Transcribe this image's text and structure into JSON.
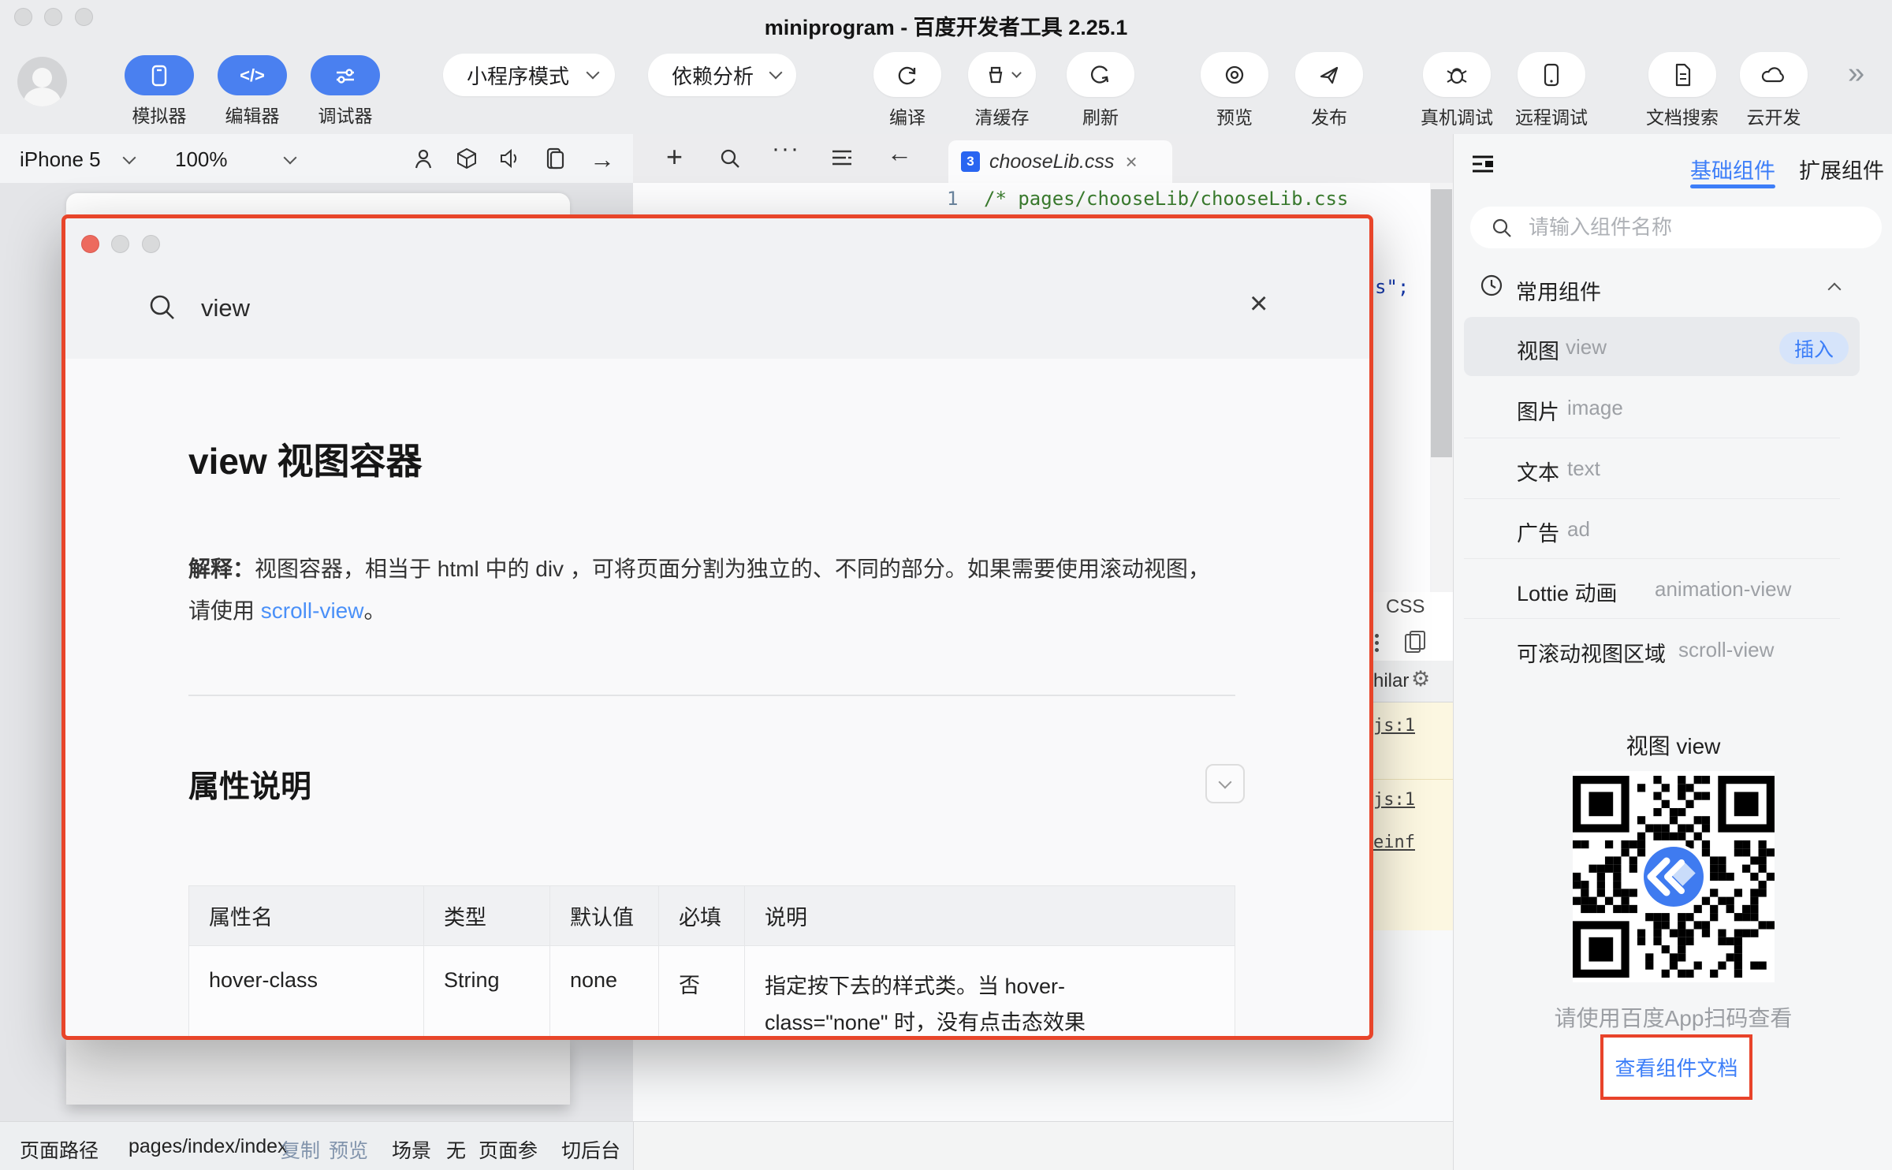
{
  "window": {
    "title": "miniprogram - 百度开发者工具 2.25.1"
  },
  "toolbar": {
    "toggles": [
      {
        "label": "模拟器"
      },
      {
        "label": "编辑器"
      },
      {
        "label": "调试器"
      }
    ],
    "mode_dropdown": "小程序模式",
    "analysis_dropdown": "依赖分析",
    "actions": [
      {
        "label": "编译"
      },
      {
        "label": "清缓存"
      },
      {
        "label": "刷新"
      },
      {
        "label": "预览"
      },
      {
        "label": "发布"
      },
      {
        "label": "真机调试"
      },
      {
        "label": "远程调试"
      },
      {
        "label": "文档搜索"
      },
      {
        "label": "云开发"
      }
    ],
    "more_glyph": "»"
  },
  "simbar": {
    "device": "iPhone 5",
    "zoom": "100%"
  },
  "editorbar": {
    "plus": "+",
    "ellipsis": "···",
    "back": "←",
    "forward": "→"
  },
  "editor": {
    "tab_name": "chooseLib.css",
    "tab_close": "×",
    "css_badge": "3",
    "line_number": "1",
    "line1": "/* pages/chooseLib/chooseLib.css",
    "line2_fragment": "s\";"
  },
  "devtools": {
    "css_tab": "CSS",
    "similar_fragment": "hilar",
    "gear_glyph": "⚙",
    "console_links": [
      "js:1",
      "js:1",
      "einf"
    ]
  },
  "components_panel": {
    "tabs": [
      "基础组件",
      "扩展组件"
    ],
    "search_placeholder": "请输入组件名称",
    "group_title": "常用组件",
    "items": [
      {
        "zh": "视图",
        "en": "view",
        "action": "插入"
      },
      {
        "zh": "图片",
        "en": "image"
      },
      {
        "zh": "文本",
        "en": "text"
      },
      {
        "zh": "广告",
        "en": "ad"
      },
      {
        "zh": "Lottie 动画",
        "en": "animation-view"
      },
      {
        "zh": "可滚动视图区域",
        "en": "scroll-view"
      }
    ],
    "preview_title": "视图 view",
    "qr_caption": "请使用百度App扫码查看",
    "doc_button": "查看组件文档"
  },
  "modal": {
    "search_value": "view",
    "close": "×",
    "doc_title": "view 视图容器",
    "desc_label": "解释：",
    "desc_line1": "视图容器，相当于 html 中的 div ，可将页面分割为独立的、不同的部分。如果需要使用滚动视图，",
    "desc_line2_prefix": "请使用 ",
    "desc_link": "scroll-view",
    "desc_suffix": "。",
    "section_title": "属性说明",
    "table": {
      "headers": [
        "属性名",
        "类型",
        "默认值",
        "必填",
        "说明"
      ],
      "rows": [
        [
          "hover-class",
          "String",
          "none",
          "否",
          "指定按下去的样式类。当 hover-class=\"none\" 时，没有点击态效果"
        ]
      ]
    }
  },
  "statusbar": {
    "path_label": "页面路径",
    "path": "pages/index/index",
    "copy": "复制",
    "preview": "预览",
    "scene_label": "场景",
    "scene_value": "无",
    "page_param": "页面参",
    "to_background": "切后台"
  },
  "colors": {
    "accent_blue": "#3d7ef8",
    "button_blue": "#4a80f0",
    "annotation_red": "#e8452a",
    "insert_pill_bg": "#d6e4fa",
    "console_yellow": "#fcf7e1",
    "code_comment_green": "#3b7d2f"
  }
}
